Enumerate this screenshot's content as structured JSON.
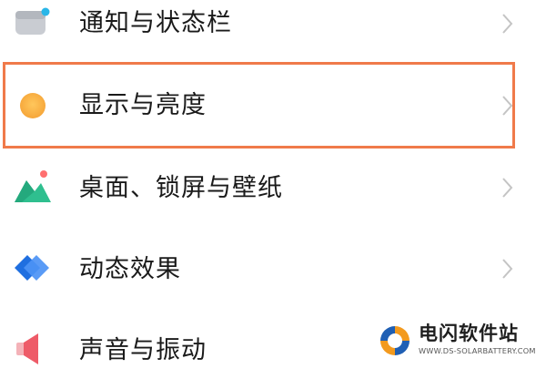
{
  "settings": {
    "items": [
      {
        "label": "通知与状态栏",
        "icon": "notification-bar-icon"
      },
      {
        "label": "显示与亮度",
        "icon": "brightness-sun-icon",
        "highlighted": true
      },
      {
        "label": "桌面、锁屏与壁纸",
        "icon": "wallpaper-mountain-icon"
      },
      {
        "label": "动态效果",
        "icon": "animation-diamond-icon"
      },
      {
        "label": "声音与振动",
        "icon": "speaker-icon"
      }
    ]
  },
  "highlight": {
    "color": "#f07a4a"
  },
  "watermark": {
    "title": "电闪软件站",
    "url": "WWW.DS-SOLARBATTERY.COM",
    "colors": {
      "orange": "#f39a1e",
      "blue": "#1f5fb4"
    }
  }
}
